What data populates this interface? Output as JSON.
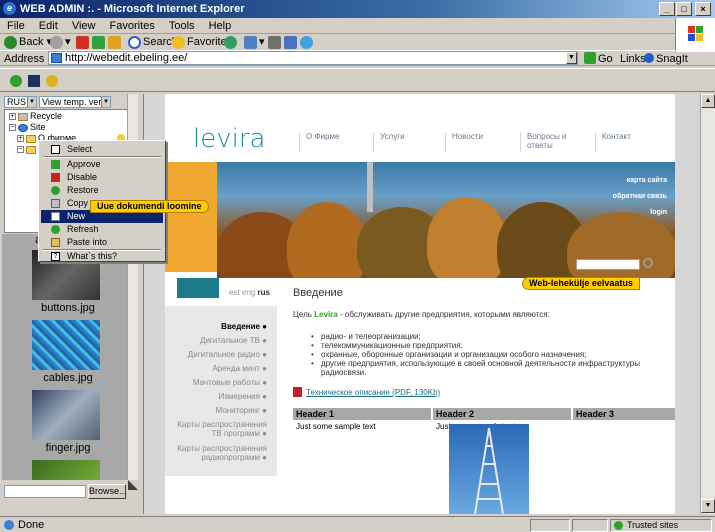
{
  "window": {
    "title": "WEB ADMIN :. - Microsoft Internet Explorer"
  },
  "menu": [
    "File",
    "Edit",
    "View",
    "Favorites",
    "Tools",
    "Help"
  ],
  "toolbar": {
    "back": "Back",
    "search": "Search",
    "favorites": "Favorites"
  },
  "address": {
    "label": "Address",
    "url": "http://webedit.ebeling.ee/",
    "go": "Go",
    "links": "Links",
    "snagit": "SnagIt"
  },
  "left_panel": {
    "language": "RUS",
    "view": "View temp. ver.",
    "tree": [
      {
        "label": "Recycle"
      },
      {
        "label": "Site"
      },
      {
        "label": "О фирме"
      },
      {
        "label": "Yc"
      }
    ],
    "thumbs": [
      {
        "label": "ar"
      },
      {
        "label": "buttons.jpg"
      },
      {
        "label": "cables.jpg"
      },
      {
        "label": "finger.jpg"
      }
    ],
    "browse": "Browse..."
  },
  "context_menu": {
    "items": [
      "Select",
      "Approve",
      "Disable",
      "Restore",
      "Copy c",
      "New",
      "Refresh",
      "Paste into",
      "What`s this?"
    ],
    "highlighted": "New"
  },
  "tooltips": {
    "new_doc": "Uue dokumendi loomine",
    "preview": "Web-lehekülje eelvaatus"
  },
  "site": {
    "logo": "levira",
    "nav": [
      "О Фирме",
      "Услуги",
      "Новости",
      "Вопросы и ответы",
      "Контакт"
    ],
    "banner_links": [
      "карта сайта",
      "обратная связь",
      "login"
    ],
    "langs": [
      "est",
      "eng",
      "rus"
    ],
    "intro_title": "Введение",
    "left_nav": [
      "Введение",
      "Дигитальное ТВ",
      "Дигитальное радио",
      "Аренда мачт",
      "Мачтовые работы",
      "Измерения",
      "Мониторинг",
      "Карты распространения ТВ программ",
      "Карты распространения радиопрограмм"
    ],
    "intro_prefix": "Цель",
    "intro_brand": "Levira",
    "intro_suffix": "- обслуживать другие предприятия, которыми являются:",
    "bullets": [
      "радио- и телеорганизации;",
      "телекоммуникационные предприятия;",
      "охранные, оборонные организации и организации особого назначения;",
      "другие предприятия, использующие в своей основной деятельности инфраструктуры радиосвязи."
    ],
    "pdf_link": "Техническое описание (PDF, 130Kb)",
    "table_headers": [
      "Header 1",
      "Header 2",
      "Header 3"
    ],
    "table_cells": [
      "Just some sample text",
      "Just some sample text"
    ]
  },
  "status": {
    "text": "Done",
    "zone": "Trusted sites"
  },
  "colors": {
    "brand_teal": "#1a8a96",
    "brand_orange": "#f0a830",
    "tooltip": "#ffcc00",
    "highlight": "#0a246a"
  }
}
